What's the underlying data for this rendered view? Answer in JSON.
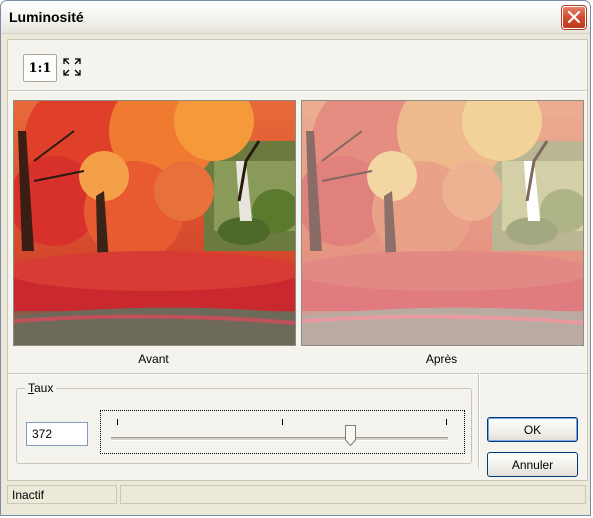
{
  "window": {
    "title": "Luminosité"
  },
  "toolbar": {
    "zoom_1to1_label": "1:1",
    "fit_icon": "fit-to-window-icon"
  },
  "preview": {
    "before_caption": "Avant",
    "after_caption": "Après"
  },
  "rate": {
    "group_label_mnemonic": "T",
    "group_label_rest": "aux",
    "value": "372",
    "slider_fraction": 0.71
  },
  "buttons": {
    "ok_label": "OK",
    "cancel_label": "Annuler"
  },
  "status": {
    "text": "Inactif"
  },
  "colors": {
    "titlebar": "#f2f1ec",
    "panel": "#f4f3ee",
    "close_button": "#d24a2c",
    "button_border": "#003c74"
  }
}
